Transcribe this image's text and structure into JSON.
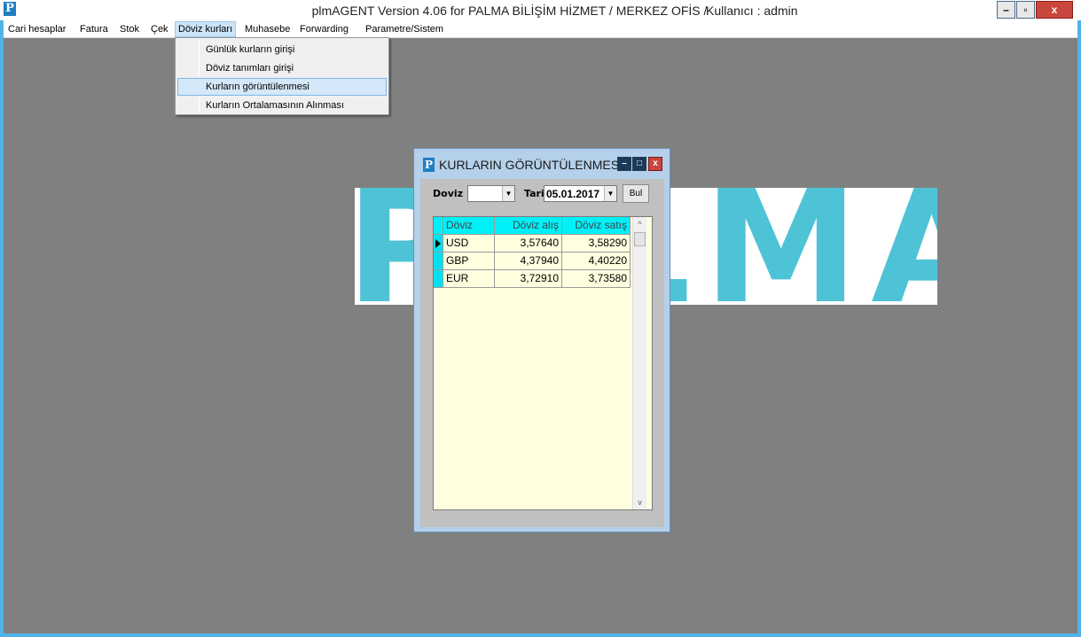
{
  "titlebar": {
    "logo": "P",
    "title": "plmAGENT  Version 4.06 for  PALMA BİLİŞİM HİZMET  /   MERKEZ OFİS /",
    "user": "Kullanıcı : admin",
    "min_symbol": "–",
    "restore_symbol": "▫",
    "close_symbol": "x"
  },
  "menubar": {
    "items": [
      {
        "label": "Cari hesaplar"
      },
      {
        "label": "Fatura"
      },
      {
        "label": "Stok"
      },
      {
        "label": "Çek"
      },
      {
        "label": "Döviz kurları"
      },
      {
        "label": "Muhasebe"
      },
      {
        "label": "Forwarding"
      },
      {
        "label": "Parametre/Sistem"
      }
    ],
    "active": "Döviz kurları"
  },
  "dropdown": {
    "items": [
      {
        "label": "Günlük kurların girişi"
      },
      {
        "label": "Döviz tanımları girişi"
      },
      {
        "label": "Kurların görüntülenmesi"
      },
      {
        "label": "Kurların Ortalamasının Alınması"
      }
    ],
    "highlighted": "Kurların görüntülenmesi"
  },
  "background_logo": {
    "text": "PALMA",
    "color": "#4fc3d6"
  },
  "child_window": {
    "logo": "P",
    "title": "KURLARIN GÖRÜNTÜLENMESİ",
    "min_symbol": "–",
    "max_symbol": "□",
    "close_symbol": "x",
    "form": {
      "doviz_label": "Doviz",
      "doviz_value": "",
      "tarih_label": "Tarih",
      "tarih_value": "05.01.2017",
      "bul_label": "Bul",
      "combo_arrow": "▼"
    },
    "grid": {
      "columns": [
        "Döviz",
        "Döviz alış",
        "Döviz satış"
      ],
      "rows": [
        {
          "doviz": "USD",
          "alis": "3,57640",
          "satis": "3,58290",
          "current": true
        },
        {
          "doviz": "GBP",
          "alis": "4,37940",
          "satis": "4,40220",
          "current": false
        },
        {
          "doviz": "EUR",
          "alis": "3,72910",
          "satis": "3,73580",
          "current": false
        }
      ],
      "scroll_up": "^",
      "scroll_down": "v"
    }
  },
  "colors": {
    "accent": "#1e7fc1",
    "grid_header": "#00f0f8",
    "grid_bg": "#fffedf",
    "desktop": "#808080"
  }
}
